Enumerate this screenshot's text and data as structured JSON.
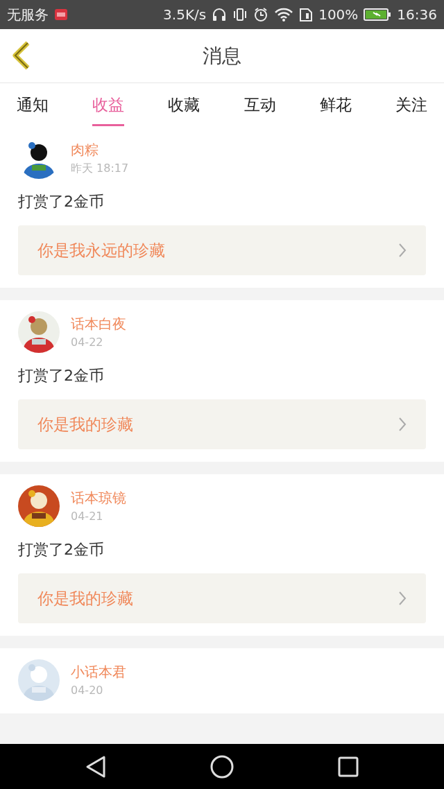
{
  "status_bar": {
    "carrier": "无服务",
    "speed": "3.5K/s",
    "battery": "100%",
    "time": "16:36"
  },
  "header": {
    "title": "消息"
  },
  "tabs": [
    {
      "label": "通知",
      "selected": false
    },
    {
      "label": "收益",
      "selected": true
    },
    {
      "label": "收藏",
      "selected": false
    },
    {
      "label": "互动",
      "selected": false
    },
    {
      "label": "鲜花",
      "selected": false
    },
    {
      "label": "关注",
      "selected": false
    }
  ],
  "messages": [
    {
      "name": "肉粽",
      "time": "昨天 18:17",
      "action": "打赏了2金币",
      "quote": "你是我永远的珍藏"
    },
    {
      "name": "话本白夜",
      "time": "04-22",
      "action": "打赏了2金币",
      "quote": "你是我的珍藏"
    },
    {
      "name": "话本琼镜",
      "time": "04-21",
      "action": "打赏了2金币",
      "quote": "你是我的珍藏"
    },
    {
      "name": "小话本君",
      "time": "04-20"
    }
  ]
}
